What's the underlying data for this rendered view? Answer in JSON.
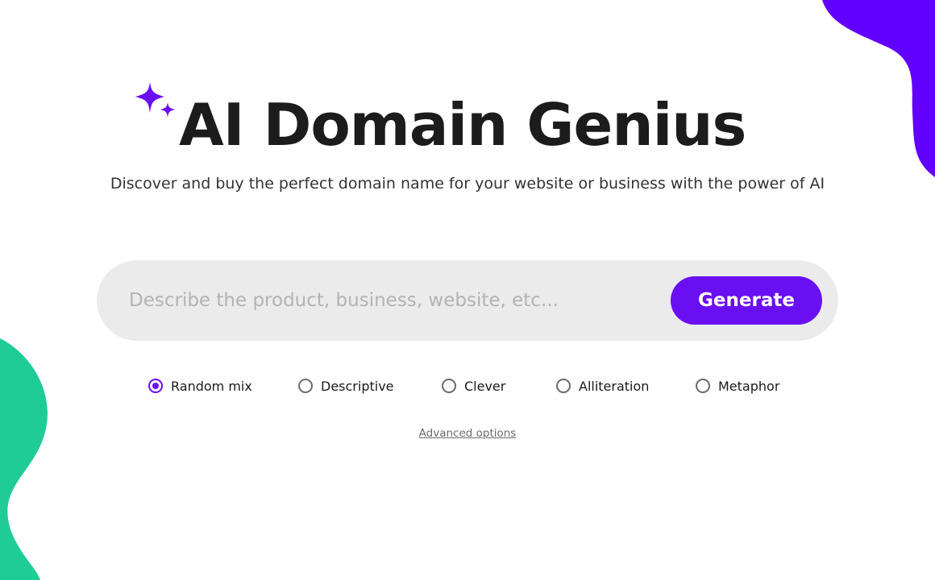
{
  "header": {
    "title": "AI Domain Genius",
    "subtitle": "Discover and buy the perfect domain name for your website or business with the power of AI"
  },
  "search": {
    "placeholder": "Describe the product, business, website, etc...",
    "value": "",
    "button_label": "Generate"
  },
  "styles": {
    "selected": "Random mix",
    "options": [
      {
        "label": "Random mix",
        "selected": true
      },
      {
        "label": "Descriptive",
        "selected": false
      },
      {
        "label": "Clever",
        "selected": false
      },
      {
        "label": "Alliteration",
        "selected": false
      },
      {
        "label": "Metaphor",
        "selected": false
      }
    ]
  },
  "advanced_options_label": "Advanced options",
  "colors": {
    "accent": "#6a0ff2",
    "decor_purple": "#6200ff",
    "decor_green": "#1fcc96",
    "search_bg": "#ebebeb",
    "title": "#1c1c1c"
  },
  "icons": {
    "logo": "sparkle-icon"
  }
}
